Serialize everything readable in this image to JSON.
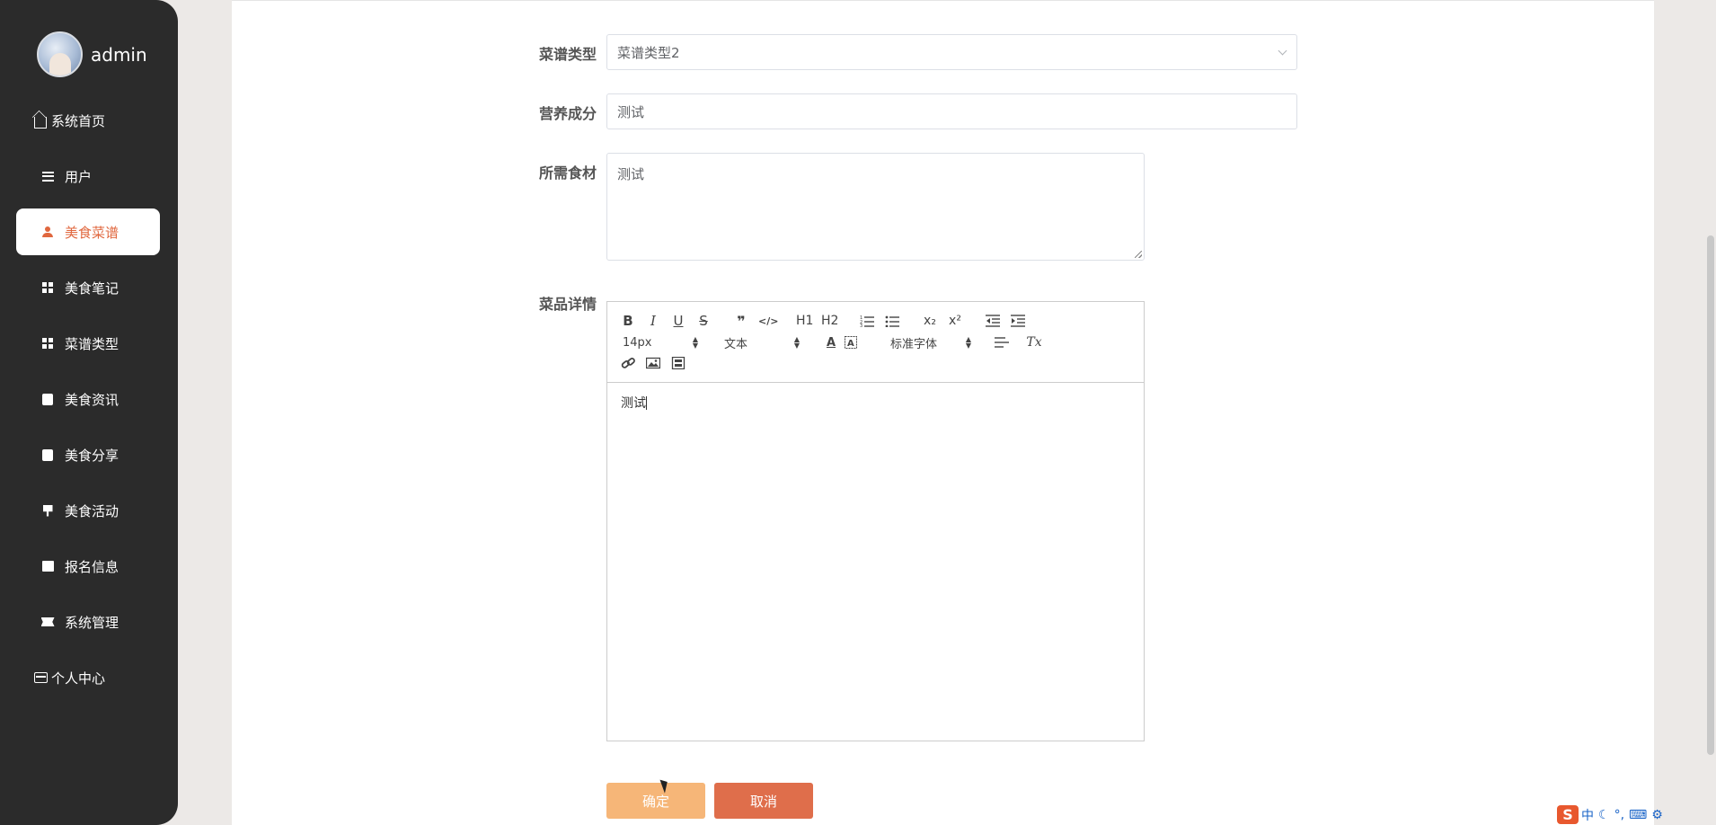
{
  "user": {
    "name": "admin"
  },
  "sidebar": {
    "items": [
      {
        "label": "系统首页",
        "icon": "home-icon"
      },
      {
        "label": "用户",
        "icon": "list-icon"
      },
      {
        "label": "美食菜谱",
        "icon": "person-icon",
        "active": true
      },
      {
        "label": "美食笔记",
        "icon": "grid-icon"
      },
      {
        "label": "菜谱类型",
        "icon": "grid-icon"
      },
      {
        "label": "美食资讯",
        "icon": "clipboard-check-icon"
      },
      {
        "label": "美食分享",
        "icon": "clipboard-icon"
      },
      {
        "label": "美食活动",
        "icon": "flag-icon"
      },
      {
        "label": "报名信息",
        "icon": "chart-icon"
      },
      {
        "label": "系统管理",
        "icon": "ticket-icon"
      },
      {
        "label": "个人中心",
        "icon": "card-icon"
      }
    ]
  },
  "form": {
    "recipe_type": {
      "label": "菜谱类型",
      "value": "菜谱类型2"
    },
    "nutrition": {
      "label": "营养成分",
      "value": "测试"
    },
    "ingredients": {
      "label": "所需食材",
      "value": "测试"
    },
    "details": {
      "label": "菜品详情",
      "value": "测试"
    }
  },
  "editor": {
    "font_size": "14px",
    "header_select": "文本",
    "font_family": "标准字体",
    "buttons": {
      "bold": "B",
      "italic": "I",
      "underline": "U",
      "strike": "S",
      "blockquote": "❞",
      "code": "</>",
      "h1": "H1",
      "h2": "H2",
      "sub": "x₂",
      "sup": "x²",
      "color": "A",
      "clean": "Tx"
    }
  },
  "actions": {
    "confirm": "确定",
    "cancel": "取消"
  },
  "tray": {
    "logo": "S",
    "ime": "中"
  },
  "colors": {
    "accent": "#e0673e",
    "sidebar_bg": "#2b2b2b",
    "confirm": "#f6b678",
    "cancel": "#df6e4b"
  }
}
